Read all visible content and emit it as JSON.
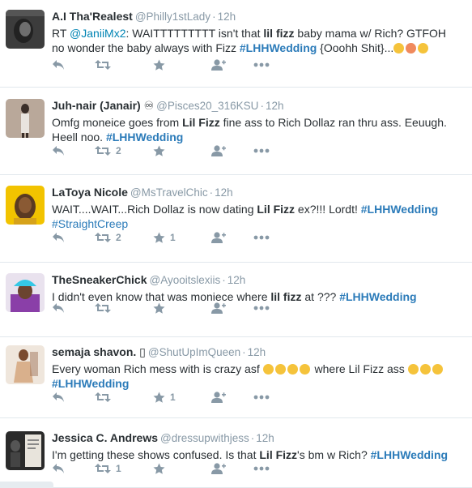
{
  "tweets": [
    {
      "fullname": "A.I Tha'Realest",
      "handle": "@Philly1stLady",
      "time": "12h",
      "line1": [
        {
          "t": "RT ",
          "s": ""
        },
        {
          "t": "@JaniiMx2",
          "s": "link"
        },
        {
          "t": ": WAITTTTTTTTT isn't that ",
          "s": ""
        },
        {
          "t": "lil fizz",
          "s": "b"
        },
        {
          "t": " baby mama w/ Rich? GTFOH",
          "s": ""
        }
      ],
      "line2": [
        {
          "t": "no wonder the baby always with Fizz ",
          "s": ""
        },
        {
          "t": "#LHHWedding",
          "s": "tag"
        },
        {
          "t": " {Ooohh Shit}...",
          "s": ""
        }
      ],
      "emojis": [
        "scream",
        "tongue",
        "smile"
      ],
      "counts": {
        "retweets": "",
        "favorites": ""
      },
      "avatar": "dark-portrait",
      "colors": {
        "bg": "#3c3c3c",
        "accent": "#6e6e6e"
      }
    },
    {
      "fullname": "Juh-nair (Janair)",
      "name_suffix": "♾",
      "handle": "@Pisces20_316KSU",
      "time": "12h",
      "line1": [
        {
          "t": "Omfg moneice goes from ",
          "s": ""
        },
        {
          "t": "Lil Fizz",
          "s": "b"
        },
        {
          "t": " fine ass to Rich Dollaz ran thru ass. Eeuugh.",
          "s": ""
        }
      ],
      "line2": [
        {
          "t": "Heell noo. ",
          "s": ""
        },
        {
          "t": "#LHHWedding",
          "s": "tag"
        }
      ],
      "counts": {
        "retweets": "2",
        "favorites": ""
      },
      "avatar": "mirror-selfie",
      "colors": {
        "bg": "#b9a89a",
        "accent": "#3a2e28"
      }
    },
    {
      "fullname": "LaToya Nicole",
      "handle": "@MsTravelChic",
      "time": "12h",
      "line1": [
        {
          "t": "WAIT....WAIT...Rich Dollaz is now dating ",
          "s": ""
        },
        {
          "t": "Lil Fizz",
          "s": "b"
        },
        {
          "t": " ex?!!! Lordt! ",
          "s": ""
        },
        {
          "t": "#LHHWedding",
          "s": "tag"
        }
      ],
      "line2": [
        {
          "t": "#StraightCreep",
          "s": "hash"
        }
      ],
      "counts": {
        "retweets": "2",
        "favorites": "1"
      },
      "avatar": "yellow-portrait",
      "colors": {
        "bg": "#f2c300",
        "accent": "#5a3a22"
      }
    },
    {
      "fullname": "TheSneakerChick",
      "handle": "@Ayooitslexiis",
      "time": "12h",
      "line1": [
        {
          "t": "I didn't even know that was moniece where ",
          "s": ""
        },
        {
          "t": "lil fizz",
          "s": "b"
        },
        {
          "t": " at ??? ",
          "s": ""
        },
        {
          "t": "#LHHWedding",
          "s": "tag"
        }
      ],
      "line2": [],
      "counts": {
        "retweets": "",
        "favorites": ""
      },
      "avatar": "purple-cap",
      "colors": {
        "bg": "#8a3fa8",
        "accent": "#35c8e6"
      }
    },
    {
      "fullname": "semaja shavon.",
      "name_suffix": "▯",
      "handle": "@ShutUpImQueen",
      "time": "12h",
      "line1": [
        {
          "t": "Every woman Rich mess with is crazy asf ",
          "s": ""
        }
      ],
      "line1_emojis": [
        "unamused",
        "unamused",
        "unamused",
        "unamused"
      ],
      "line1_after": [
        {
          "t": " where Lil Fizz ass ",
          "s": ""
        }
      ],
      "line1_tail_emojis": [
        "joy",
        "joy",
        "joy"
      ],
      "line2": [
        {
          "t": "#LHHWedding",
          "s": "tag"
        }
      ],
      "counts": {
        "retweets": "",
        "favorites": "1"
      },
      "avatar": "pose-photo",
      "colors": {
        "bg": "#d9b08c",
        "accent": "#7a4a2e"
      }
    },
    {
      "fullname": "Jessica C. Andrews",
      "handle": "@dressupwithjess",
      "time": "12h",
      "line1": [
        {
          "t": "I'm getting these shows confused. Is that ",
          "s": ""
        },
        {
          "t": "Lil Fizz",
          "s": "b"
        },
        {
          "t": "'s bm w Rich? ",
          "s": ""
        },
        {
          "t": "#LHHWedding",
          "s": "tag"
        }
      ],
      "line2": [],
      "counts": {
        "retweets": "1",
        "favorites": ""
      },
      "avatar": "book-cover",
      "colors": {
        "bg": "#2a2a2a",
        "accent": "#e8e4dc"
      }
    }
  ]
}
